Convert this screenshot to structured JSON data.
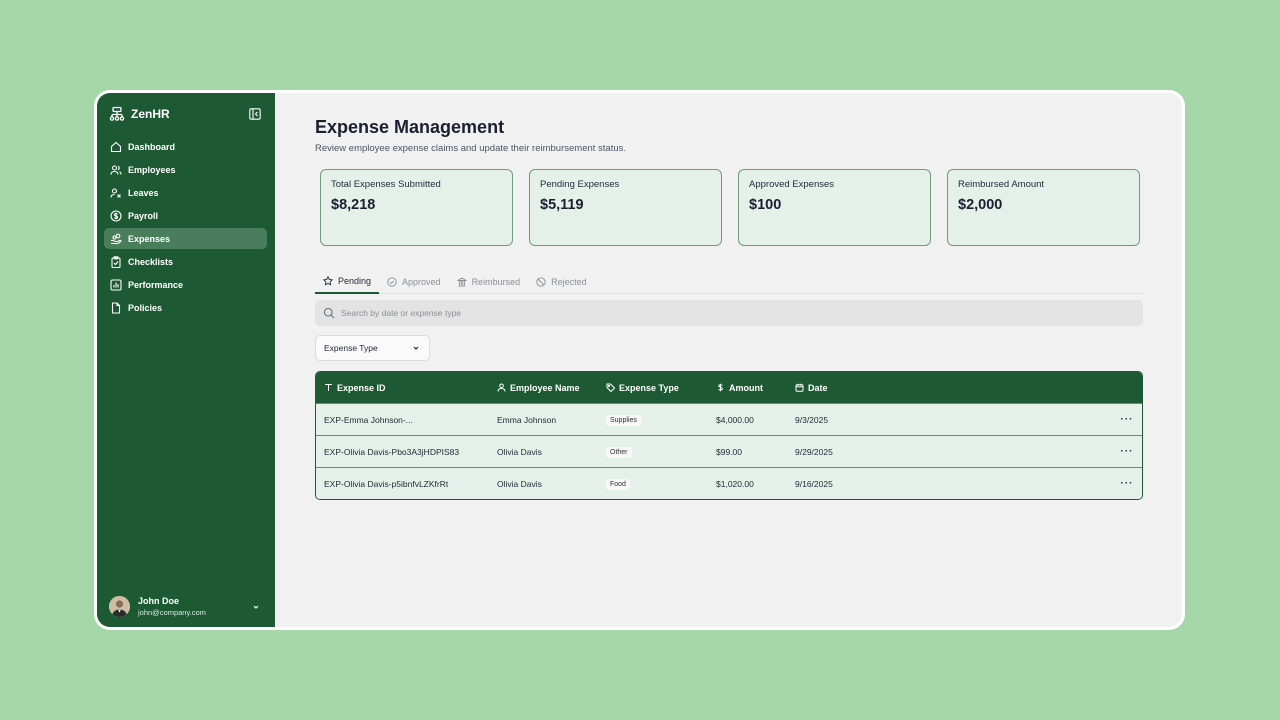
{
  "app": {
    "name": "ZenHR"
  },
  "sidebar": {
    "items": [
      {
        "label": "Dashboard",
        "icon": "home-icon"
      },
      {
        "label": "Employees",
        "icon": "users-icon"
      },
      {
        "label": "Leaves",
        "icon": "user-x-icon"
      },
      {
        "label": "Payroll",
        "icon": "dollar-circle-icon"
      },
      {
        "label": "Expenses",
        "icon": "coins-hand-icon",
        "active": true
      },
      {
        "label": "Checklists",
        "icon": "clipboard-check-icon"
      },
      {
        "label": "Performance",
        "icon": "bar-chart-icon"
      },
      {
        "label": "Policies",
        "icon": "file-icon"
      }
    ],
    "user": {
      "name": "John Doe",
      "email": "john@company.com"
    }
  },
  "page": {
    "title": "Expense Management",
    "subtitle": "Review employee expense claims and update their reimbursement status."
  },
  "stats": [
    {
      "label": "Total Expenses Submitted",
      "value": "$8,218"
    },
    {
      "label": "Pending Expenses",
      "value": "$5,119"
    },
    {
      "label": "Approved Expenses",
      "value": "$100"
    },
    {
      "label": "Reimbursed Amount",
      "value": "$2,000"
    }
  ],
  "tabs": [
    {
      "label": "Pending",
      "icon": "star-icon",
      "active": true
    },
    {
      "label": "Approved",
      "icon": "check-circle-icon"
    },
    {
      "label": "Reimbursed",
      "icon": "bank-icon"
    },
    {
      "label": "Rejected",
      "icon": "ban-icon"
    }
  ],
  "search": {
    "placeholder": "Search by date or expense type"
  },
  "filter": {
    "label": "Expense Type"
  },
  "table": {
    "headers": [
      "Expense ID",
      "Employee Name",
      "Expense Type",
      "Amount",
      "Date"
    ],
    "rows": [
      {
        "id": "EXP-Emma Johnson-...",
        "name": "Emma Johnson",
        "type": "Supplies",
        "amount": "$4,000.00",
        "date": "9/3/2025"
      },
      {
        "id": "EXP-Olivia Davis-Pbo3A3jHDPIS83",
        "name": "Olivia Davis",
        "type": "Other",
        "amount": "$99.00",
        "date": "9/29/2025"
      },
      {
        "id": "EXP-Olivia Davis-p5ibnfvLZKfrRt",
        "name": "Olivia Davis",
        "type": "Food",
        "amount": "$1,020.00",
        "date": "9/16/2025"
      }
    ],
    "row_action": "···"
  },
  "colors": {
    "brand": "#1d5a34",
    "card_bg": "#e5f0e9",
    "backdrop": "#a5d6a7"
  }
}
